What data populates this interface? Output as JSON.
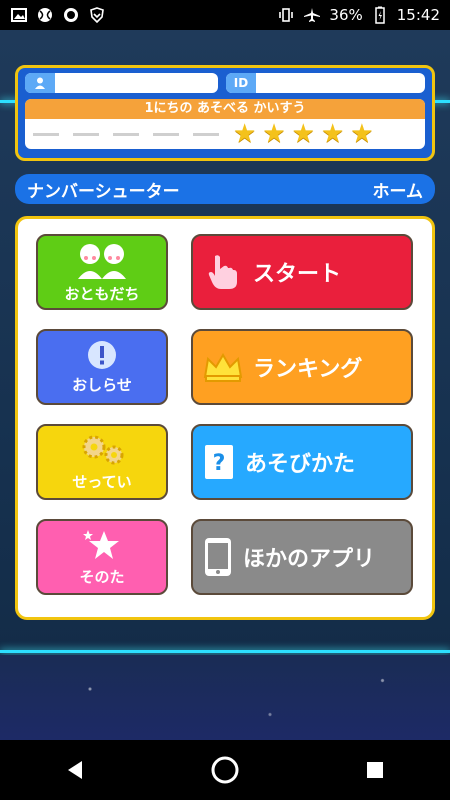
{
  "status_bar": {
    "battery_percent": "36%",
    "time": "15:42",
    "icons": [
      "gallery-icon",
      "ball-icon",
      "circle-icon",
      "shield-icon",
      "vibrate-icon",
      "airplane-icon",
      "battery-icon"
    ]
  },
  "profile": {
    "id_label": "ID",
    "plays_title": "1にちの あそべる かいすう",
    "stars_count": 5,
    "dashes_count": 5
  },
  "header": {
    "title": "ナンバーシューター",
    "home": "ホーム"
  },
  "menu": {
    "friends": "おともだち",
    "news": "おしらせ",
    "settings": "せってい",
    "other": "そのた",
    "start": "スタート",
    "ranking": "ランキング",
    "howto": "あそびかた",
    "other_apps": "ほかのアプリ"
  },
  "colors": {
    "panel_border": "#f1c40f",
    "accent_blue": "#1b72e6",
    "green": "#5fcd15",
    "blue": "#4a6ef0",
    "yellow": "#f6d60d",
    "pink": "#ff5fb0",
    "red": "#ea1f3c",
    "orange": "#ffa021",
    "cyan": "#26a9ff",
    "gray": "#8a8a8a"
  }
}
